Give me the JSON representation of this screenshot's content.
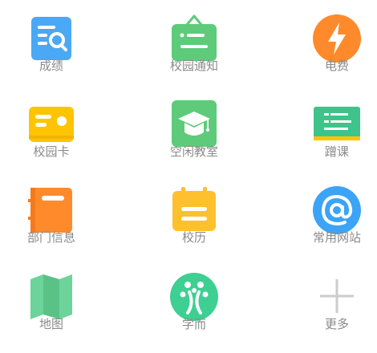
{
  "grid": {
    "items": [
      {
        "label": "成绩",
        "icon": "grades-search-icon",
        "color": "#4BA8F5"
      },
      {
        "label": "校园通知",
        "icon": "notice-board-icon",
        "color": "#5DCB7A"
      },
      {
        "label": "电费",
        "icon": "lightning-bolt-icon",
        "color": "#FF8A2B"
      },
      {
        "label": "校园卡",
        "icon": "campus-card-icon",
        "color": "#FFC400"
      },
      {
        "label": "空闲教室",
        "icon": "graduation-cap-icon",
        "color": "#5DCB7A"
      },
      {
        "label": "蹭课",
        "icon": "blackboard-icon",
        "color": "#3EC48A"
      },
      {
        "label": "部门信息",
        "icon": "department-book-icon",
        "color": "#FF8A2B"
      },
      {
        "label": "校历",
        "icon": "calendar-icon",
        "color": "#FFC02E"
      },
      {
        "label": "常用网站",
        "icon": "at-sign-icon",
        "color": "#3BA4F7"
      },
      {
        "label": "地图",
        "icon": "folded-map-icon",
        "color": "#6CD39A"
      },
      {
        "label": "学而",
        "icon": "xueer-logo-icon",
        "color": "#3ECF93"
      },
      {
        "label": "更多",
        "icon": "plus-icon",
        "color": "#CCCCCC"
      }
    ]
  }
}
